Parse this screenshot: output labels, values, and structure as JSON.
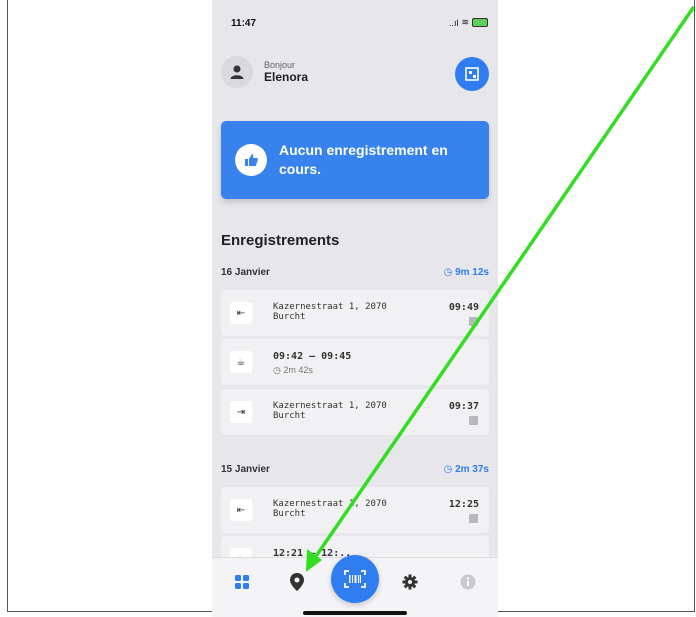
{
  "status": {
    "time": "11:47",
    "signal": "..ıl",
    "wifi": "≋"
  },
  "header": {
    "greeting": "Bonjour",
    "name": "Elenora"
  },
  "banner": {
    "text": "Aucun enregistrement en cours."
  },
  "section_title": "Enregistrements",
  "days": [
    {
      "date": "16 Janvier",
      "duration": "9m 12s",
      "entries": [
        {
          "icon": "⇤",
          "address_line1": "Kazernestraat 1, 2070",
          "address_line2": "Burcht",
          "time": "09:49"
        },
        {
          "icon": "☕",
          "range": "09:42  –  09:45",
          "sub": "2m 42s"
        },
        {
          "icon": "⇥",
          "address_line1": "Kazernestraat 1, 2070",
          "address_line2": "Burcht",
          "time": "09:37"
        }
      ]
    },
    {
      "date": "15 Janvier",
      "duration": "2m 37s",
      "entries": [
        {
          "icon": "⇤",
          "address_line1": "Kazernestraat 1, 2070",
          "address_line2": "Burcht",
          "time": "12:25"
        },
        {
          "icon": "☕",
          "range": "12:21  –  12:..",
          "sub": ""
        }
      ]
    }
  ],
  "tabbar": {
    "items": [
      "dashboard-icon",
      "map-pin-icon",
      "scan-icon",
      "gear-icon",
      "info-icon"
    ]
  },
  "colors": {
    "accent": "#2f7df0",
    "annotation_arrow": "#33dd22"
  }
}
